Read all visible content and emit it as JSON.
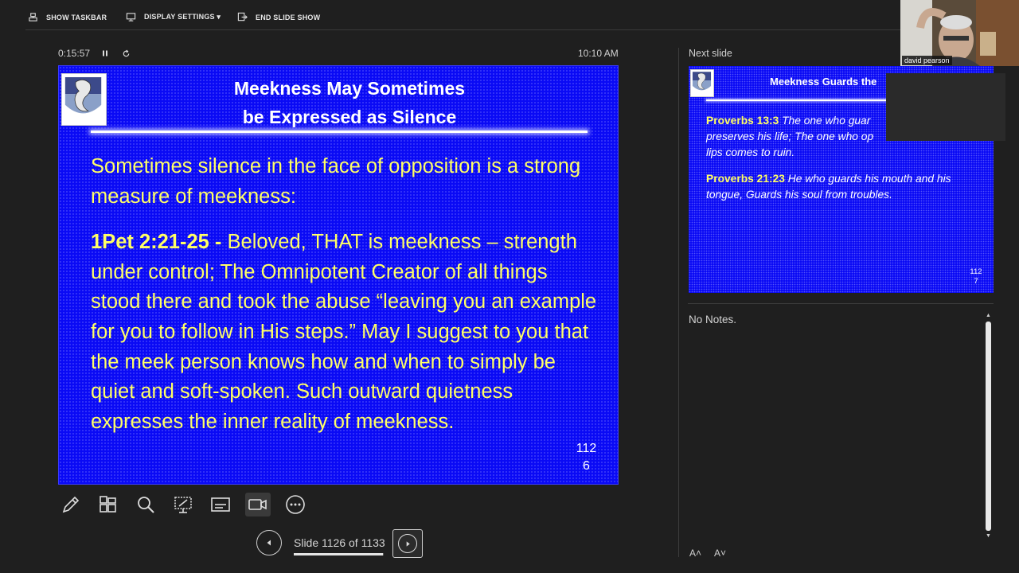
{
  "toolbar": {
    "show_taskbar": "SHOW TASKBAR",
    "display_settings": "DISPLAY SETTINGS ▾",
    "end_slide_show": "END SLIDE SHOW"
  },
  "timer": {
    "elapsed": "0:15:57",
    "clock": "10:10 AM"
  },
  "current_slide": {
    "title_line1": "Meekness May Sometimes",
    "title_line2": "be Expressed as Silence",
    "paragraph1": "Sometimes silence in the face of opposition is a strong measure of meekness:",
    "ref": "1Pet 2:21-25 -",
    "paragraph2": " Beloved, THAT is meekness – strength under control; The Omnipotent Creator of all things stood there and took the abuse “leaving you an example for you to follow in His steps.” May I suggest to you that the meek person knows how and when to simply be quiet and soft-spoken. Such outward quietness expresses the inner reality of meekness.",
    "number_line1": "112",
    "number_line2": "6"
  },
  "tools": [
    "pen-tool",
    "slide-sorter",
    "zoom",
    "laser-pointer",
    "subtitles",
    "camera",
    "more-options"
  ],
  "navigation": {
    "label": "Slide 1126 of 1133",
    "progress": 0.994
  },
  "next_slide": {
    "header": "Next slide",
    "title": "Meekness Guards the",
    "ref1": "Proverbs 13:3",
    "text1": " The one who guar",
    "text1b": "preserves his life; The one who op",
    "text1c": "lips comes to ruin.",
    "ref2": "Proverbs 21:23",
    "text2": " He who guards his mouth and his tongue, Guards his soul from troubles.",
    "number_line1": "112",
    "number_line2": "7"
  },
  "notes": {
    "text": "No Notes."
  },
  "font_controls": {
    "increase": "A˄",
    "decrease": "A˅"
  },
  "webcam": {
    "name": "david pearson"
  },
  "colors": {
    "slide_bg": "#0a0af5",
    "slide_text": "#ffff66",
    "app_bg": "#1f1f1f"
  }
}
